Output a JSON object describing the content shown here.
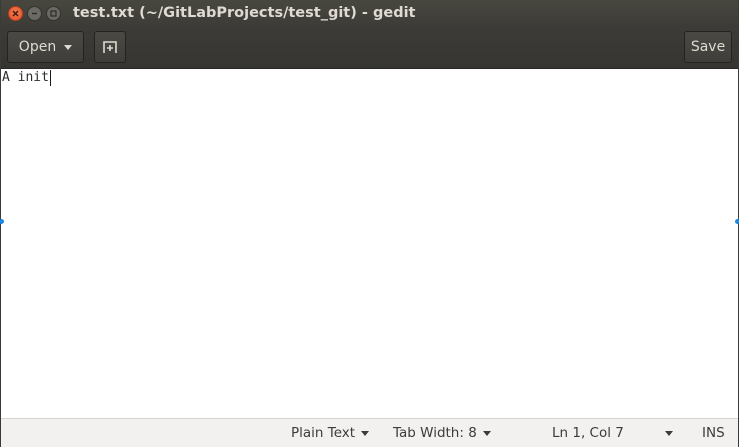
{
  "window": {
    "title": "test.txt (~/GitLabProjects/test_git) - gedit"
  },
  "toolbar": {
    "open_label": "Open",
    "new_tab_icon": "new-document-icon",
    "save_label": "Save"
  },
  "editor": {
    "line1": "A init",
    "caret": {
      "line": 1,
      "col": 7
    }
  },
  "statusbar": {
    "language": "Plain Text",
    "tab_width": "Tab Width: 8",
    "position": "Ln 1, Col 7",
    "mode": "INS"
  },
  "colors": {
    "titlebar": "#3c3b37",
    "close_button": "#e5532a",
    "selection_handle": "#1e88e5"
  }
}
